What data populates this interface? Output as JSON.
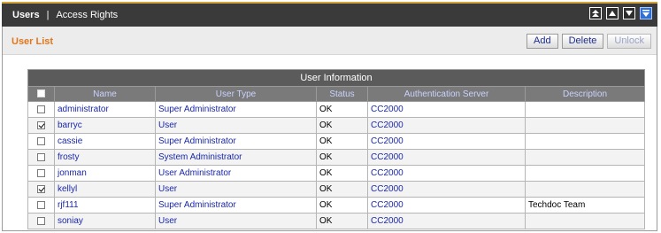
{
  "nav": {
    "active": "Users",
    "separator": "|",
    "link": "Access Rights"
  },
  "toolbar_icons": [
    "expand-icon",
    "collapse-up-icon",
    "collapse-down-icon",
    "menu-down-icon"
  ],
  "subbar": {
    "title": "User List",
    "buttons": {
      "add": "Add",
      "delete": "Delete",
      "unlock": "Unlock"
    }
  },
  "table": {
    "caption": "User Information",
    "columns": [
      "Name",
      "User Type",
      "Status",
      "Authentication Server",
      "Description"
    ],
    "rows": [
      {
        "checked": false,
        "name": "administrator",
        "user_type": "Super Administrator",
        "status": "OK",
        "auth_server": "CC2000",
        "description": ""
      },
      {
        "checked": true,
        "name": "barryc",
        "user_type": "User",
        "status": "OK",
        "auth_server": "CC2000",
        "description": ""
      },
      {
        "checked": false,
        "name": "cassie",
        "user_type": "Super Administrator",
        "status": "OK",
        "auth_server": "CC2000",
        "description": ""
      },
      {
        "checked": false,
        "name": "frosty",
        "user_type": "System Administrator",
        "status": "OK",
        "auth_server": "CC2000",
        "description": ""
      },
      {
        "checked": false,
        "name": "jonman",
        "user_type": "User Administrator",
        "status": "OK",
        "auth_server": "CC2000",
        "description": ""
      },
      {
        "checked": true,
        "name": "kellyl",
        "user_type": "User",
        "status": "OK",
        "auth_server": "CC2000",
        "description": ""
      },
      {
        "checked": false,
        "name": "rjf111",
        "user_type": "Super Administrator",
        "status": "OK",
        "auth_server": "CC2000",
        "description": "Techdoc Team"
      },
      {
        "checked": false,
        "name": "soniay",
        "user_type": "User",
        "status": "OK",
        "auth_server": "CC2000",
        "description": ""
      }
    ]
  },
  "colors": {
    "accent": "#e0771e",
    "topbar": "#3a3a3a",
    "link": "#1a28a8",
    "header": "#7a7a7a"
  }
}
